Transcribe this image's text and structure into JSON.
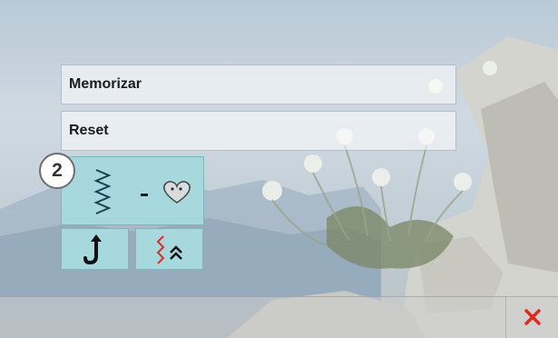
{
  "menu": {
    "memorizar_label": "Memorizar",
    "reset_label": "Reset"
  },
  "stitch_tile": {
    "separator": "-",
    "zigzag_icon": "zigzag-stitch-icon",
    "heart_icon": "heart-motif-icon"
  },
  "small_tiles": [
    {
      "icon": "needle-up-hook-icon"
    },
    {
      "icon": "stitch-balance-chevron-icon"
    }
  ],
  "callout": {
    "number": "2"
  },
  "footer": {
    "close_icon": "close-x-icon"
  },
  "colors": {
    "tile": "#a6d8dd",
    "close": "#e02a1f",
    "stitch_red": "#d6322a",
    "stitch_dark": "#1a4050"
  }
}
